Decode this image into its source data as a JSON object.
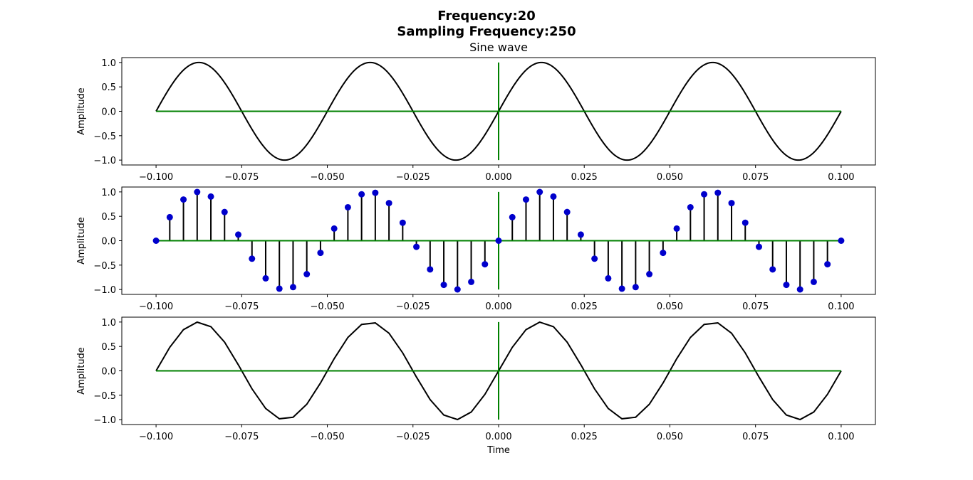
{
  "figure": {
    "title_line1": "Frequency:20",
    "title_line2": "Sampling Frequency:250"
  },
  "colors": {
    "wave": "#000000",
    "axes_lines": "#008000",
    "markers": "#0000cc",
    "frame": "#000000"
  },
  "chart_data": [
    {
      "type": "line",
      "title": "Sine wave",
      "xlabel": "",
      "ylabel": "Amplitude",
      "xlim": [
        -0.11,
        0.11
      ],
      "ylim": [
        -1.1,
        1.1
      ],
      "xticks": [
        -0.1,
        -0.075,
        -0.05,
        -0.025,
        0.0,
        0.025,
        0.05,
        0.075,
        0.1
      ],
      "xtick_labels": [
        "−0.100",
        "−0.075",
        "−0.050",
        "−0.025",
        "0.000",
        "0.025",
        "0.050",
        "0.075",
        "0.100"
      ],
      "yticks": [
        1.0,
        0.5,
        0.0,
        -0.5,
        -1.0
      ],
      "ytick_labels": [
        "1.0",
        "0.5",
        "0.0",
        "−0.5",
        "−1.0"
      ],
      "frequency": 20,
      "x_range": [
        -0.1,
        0.1
      ],
      "series": [
        {
          "values": "continuous sin(2π·20·t)"
        }
      ],
      "grid": false
    },
    {
      "type": "scatter",
      "title": "",
      "xlabel": "",
      "ylabel": "Amplitude",
      "xlim": [
        -0.11,
        0.11
      ],
      "ylim": [
        -1.1,
        1.1
      ],
      "xticks": [
        -0.1,
        -0.075,
        -0.05,
        -0.025,
        0.0,
        0.025,
        0.05,
        0.075,
        0.1
      ],
      "xtick_labels": [
        "−0.100",
        "−0.075",
        "−0.050",
        "−0.025",
        "0.000",
        "0.025",
        "0.050",
        "0.075",
        "0.100"
      ],
      "yticks": [
        1.0,
        0.5,
        0.0,
        -0.5,
        -1.0
      ],
      "ytick_labels": [
        "1.0",
        "0.5",
        "0.0",
        "−0.5",
        "−1.0"
      ],
      "sampling_frequency": 250,
      "grid": false
    },
    {
      "type": "line",
      "title": "",
      "xlabel": "Time",
      "ylabel": "Amplitude",
      "xlim": [
        -0.11,
        0.11
      ],
      "ylim": [
        -1.1,
        1.1
      ],
      "xticks": [
        -0.1,
        -0.075,
        -0.05,
        -0.025,
        0.0,
        0.025,
        0.05,
        0.075,
        0.1
      ],
      "xtick_labels": [
        "−0.100",
        "−0.075",
        "−0.050",
        "−0.025",
        "0.000",
        "0.025",
        "0.050",
        "0.075",
        "0.100"
      ],
      "yticks": [
        1.0,
        0.5,
        0.0,
        -0.5,
        -1.0
      ],
      "ytick_labels": [
        "1.0",
        "0.5",
        "0.0",
        "−0.5",
        "−1.0"
      ],
      "sampling_frequency": 250,
      "grid": false
    }
  ],
  "samples": {
    "x": [
      -0.1,
      -0.096,
      -0.092,
      -0.088,
      -0.084,
      -0.08,
      -0.076,
      -0.072,
      -0.068,
      -0.064,
      -0.06,
      -0.056,
      -0.052,
      -0.048,
      -0.044,
      -0.04,
      -0.036,
      -0.032,
      -0.028,
      -0.024,
      -0.02,
      -0.016,
      -0.012,
      -0.008,
      -0.004,
      0.0,
      0.004,
      0.008,
      0.012,
      0.016,
      0.02,
      0.024,
      0.028,
      0.032,
      0.036,
      0.04,
      0.044,
      0.048,
      0.052,
      0.056,
      0.06,
      0.064,
      0.068,
      0.072,
      0.076,
      0.08,
      0.084,
      0.088,
      0.092,
      0.096,
      0.1
    ],
    "y": [
      0.0,
      0.482,
      0.844,
      0.998,
      0.905,
      0.588,
      0.125,
      -0.368,
      -0.771,
      -0.982,
      -0.951,
      -0.685,
      -0.249,
      0.249,
      0.685,
      0.951,
      0.982,
      0.771,
      0.368,
      -0.125,
      -0.588,
      -0.905,
      -0.998,
      -0.844,
      -0.482,
      0.0,
      0.482,
      0.844,
      0.998,
      0.905,
      0.588,
      0.125,
      -0.368,
      -0.771,
      -0.982,
      -0.951,
      -0.685,
      -0.249,
      0.249,
      0.685,
      0.951,
      0.982,
      0.771,
      0.368,
      -0.125,
      -0.588,
      -0.905,
      -0.998,
      -0.844,
      -0.482,
      0.0
    ]
  }
}
